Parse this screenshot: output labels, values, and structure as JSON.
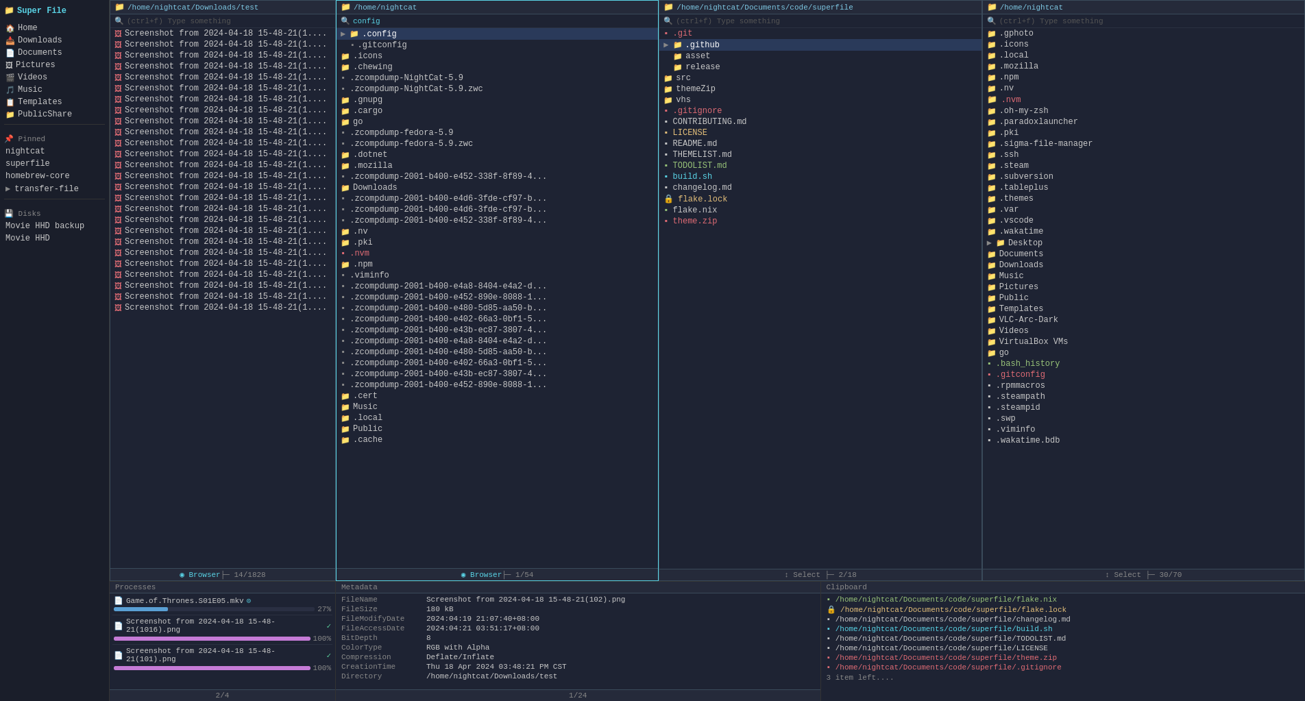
{
  "app": {
    "title": "Super File"
  },
  "sidebar": {
    "home_label": "Home",
    "pinned_label": "Pinned",
    "disks_label": "Disks",
    "items": [
      {
        "label": "Home",
        "icon": "🏠"
      },
      {
        "label": "Downloads",
        "icon": "📥"
      },
      {
        "label": "Documents",
        "icon": "📄"
      },
      {
        "label": "Pictures",
        "icon": "🖼"
      },
      {
        "label": "Videos",
        "icon": "🎬"
      },
      {
        "label": "Music",
        "icon": "🎵"
      },
      {
        "label": "Templates",
        "icon": "📋"
      },
      {
        "label": "PublicShare",
        "icon": "📁"
      }
    ],
    "pinned": [
      {
        "label": "nightcat"
      },
      {
        "label": "superfile"
      },
      {
        "label": "homebrew-core"
      },
      {
        "label": "transfer-file"
      }
    ],
    "disks": [
      {
        "label": "Movie HHD backup"
      },
      {
        "label": "Movie HHD"
      }
    ]
  },
  "panel1": {
    "path": "/home/nightcat/Downloads/test",
    "search_placeholder": "(ctrl+f) Type something",
    "files": [
      {
        "name": "Screenshot from 2024-04-18 15-48-21(1....",
        "type": "img"
      },
      {
        "name": "Screenshot from 2024-04-18 15-48-21(1....",
        "type": "img"
      },
      {
        "name": "Screenshot from 2024-04-18 15-48-21(1....",
        "type": "img"
      },
      {
        "name": "Screenshot from 2024-04-18 15-48-21(1....",
        "type": "img"
      },
      {
        "name": "Screenshot from 2024-04-18 15-48-21(1....",
        "type": "img"
      },
      {
        "name": "Screenshot from 2024-04-18 15-48-21(1....",
        "type": "img"
      },
      {
        "name": "Screenshot from 2024-04-18 15-48-21(1....",
        "type": "img"
      },
      {
        "name": "Screenshot from 2024-04-18 15-48-21(1....",
        "type": "img"
      },
      {
        "name": "Screenshot from 2024-04-18 15-48-21(1....",
        "type": "img"
      },
      {
        "name": "Screenshot from 2024-04-18 15-48-21(1....",
        "type": "img"
      },
      {
        "name": "Screenshot from 2024-04-18 15-48-21(1....",
        "type": "img"
      },
      {
        "name": "Screenshot from 2024-04-18 15-48-21(1....",
        "type": "img"
      },
      {
        "name": "Screenshot from 2024-04-18 15-48-21(1....",
        "type": "img"
      },
      {
        "name": "Screenshot from 2024-04-18 15-48-21(1....",
        "type": "img"
      },
      {
        "name": "Screenshot from 2024-04-18 15-48-21(1....",
        "type": "img"
      },
      {
        "name": "Screenshot from 2024-04-18 15-48-21(1....",
        "type": "img"
      },
      {
        "name": "Screenshot from 2024-04-18 15-48-21(1....",
        "type": "img"
      },
      {
        "name": "Screenshot from 2024-04-18 15-48-21(1....",
        "type": "img"
      },
      {
        "name": "Screenshot from 2024-04-18 15-48-21(1....",
        "type": "img"
      },
      {
        "name": "Screenshot from 2024-04-18 15-48-21(1....",
        "type": "img"
      },
      {
        "name": "Screenshot from 2024-04-18 15-48-21(1....",
        "type": "img"
      },
      {
        "name": "Screenshot from 2024-04-18 15-48-21(1....",
        "type": "img"
      },
      {
        "name": "Screenshot from 2024-04-18 15-48-21(1....",
        "type": "img"
      },
      {
        "name": "Screenshot from 2024-04-18 15-48-21(1....",
        "type": "img"
      },
      {
        "name": "Screenshot from 2024-04-18 15-48-21(1....",
        "type": "img"
      },
      {
        "name": "Screenshot from 2024-04-18 15-48-21(1....",
        "type": "img"
      }
    ],
    "footer": "◉ Browser ├─ 14/1828"
  },
  "panel2": {
    "path": "/home/nightcat",
    "search_value": "config",
    "files": [
      {
        "name": ".config",
        "type": "dir",
        "expanded": true
      },
      {
        "name": ".gitconfig",
        "type": "file"
      },
      {
        "name": ".icons",
        "type": "dir"
      },
      {
        "name": ".chewing",
        "type": "dir"
      },
      {
        "name": ".zcompdump-NightCat-5.9",
        "type": "file"
      },
      {
        "name": ".zcompdump-NightCat-5.9.zwc",
        "type": "file"
      },
      {
        "name": ".gnupg",
        "type": "dir"
      },
      {
        "name": ".cargo",
        "type": "dir"
      },
      {
        "name": "go",
        "type": "dir"
      },
      {
        "name": ".zcompdump-fedora-5.9",
        "type": "file"
      },
      {
        "name": ".zcompdump-fedora-5.9.zwc",
        "type": "file"
      },
      {
        "name": ".dotnet",
        "type": "dir"
      },
      {
        "name": ".mozilla",
        "type": "dir"
      },
      {
        "name": ".zcompdump-2001-b400-e452-338f-8f89-4...",
        "type": "file"
      },
      {
        "name": "Downloads",
        "type": "dir"
      },
      {
        "name": ".zcompdump-2001-b400-e4d6-3fde-cf97-b...",
        "type": "file"
      },
      {
        "name": ".zcompdump-2001-b400-e4d6-3fde-cf97-b...",
        "type": "file"
      },
      {
        "name": ".zcompdump-2001-b400-e452-338f-8f89-4...",
        "type": "file"
      },
      {
        "name": ".nv",
        "type": "dir"
      },
      {
        "name": ".pki",
        "type": "dir"
      },
      {
        "name": ".nvm",
        "type": "file",
        "red": true
      },
      {
        "name": ".npm",
        "type": "dir"
      },
      {
        "name": ".viminfo",
        "type": "file"
      },
      {
        "name": ".zcompdump-2001-b400-e4a8-8404-e4a2-d...",
        "type": "file"
      },
      {
        "name": ".zcompdump-2001-b400-e452-890e-8088-1...",
        "type": "file"
      },
      {
        "name": ".zcompdump-2001-b400-e480-5d85-aa50-b...",
        "type": "file"
      },
      {
        "name": ".zcompdump-2001-b400-e402-66a3-0bf1-5...",
        "type": "file"
      },
      {
        "name": ".zcompdump-2001-b400-e43b-ec87-3807-4...",
        "type": "file"
      },
      {
        "name": ".zcompdump-2001-b400-e4a8-8404-e4a2-d...",
        "type": "file"
      },
      {
        "name": ".zcompdump-2001-b400-e480-5d85-aa50-b...",
        "type": "file"
      },
      {
        "name": ".zcompdump-2001-b400-e402-66a3-0bf1-5...",
        "type": "file"
      },
      {
        "name": ".zcompdump-2001-b400-e43b-ec87-3807-4...",
        "type": "file"
      },
      {
        "name": ".zcompdump-2001-b400-e452-890e-8088-1...",
        "type": "file"
      },
      {
        "name": ".cert",
        "type": "dir"
      },
      {
        "name": "Music",
        "type": "dir"
      },
      {
        "name": ".local",
        "type": "dir"
      },
      {
        "name": "Public",
        "type": "dir"
      },
      {
        "name": ".cache",
        "type": "dir"
      }
    ],
    "footer": "◉ Browser ├─ 1/54"
  },
  "panel3": {
    "path": "/home/nightcat/Documents/code/superfile",
    "search_placeholder": "(ctrl+f) Type something",
    "files": [
      {
        "name": ".git",
        "type": "dir",
        "color": "red"
      },
      {
        "name": ".github",
        "type": "dir",
        "expanded": true
      },
      {
        "name": "asset",
        "type": "dir"
      },
      {
        "name": "release",
        "type": "dir"
      },
      {
        "name": "src",
        "type": "dir"
      },
      {
        "name": "themeZip",
        "type": "dir"
      },
      {
        "name": "vhs",
        "type": "dir"
      },
      {
        "name": ".gitignore",
        "type": "file",
        "color": "red"
      },
      {
        "name": "CONTRIBUTING.md",
        "type": "file"
      },
      {
        "name": "LICENSE",
        "type": "file",
        "color": "yellow"
      },
      {
        "name": "README.md",
        "type": "file"
      },
      {
        "name": "THEMELIST.md",
        "type": "file"
      },
      {
        "name": "TODOLIST.md",
        "type": "file",
        "color": "green"
      },
      {
        "name": "build.sh",
        "type": "file",
        "color": "green"
      },
      {
        "name": "changelog.md",
        "type": "file"
      },
      {
        "name": "flake.lock",
        "type": "file",
        "color": "yellow"
      },
      {
        "name": "flake.nix",
        "type": "file"
      },
      {
        "name": "theme.zip",
        "type": "file",
        "color": "red"
      }
    ],
    "footer": "↕ Select ├─ 2/18"
  },
  "panel4": {
    "path": "/home/nightcat",
    "search_placeholder": "(ctrl+f) Type something",
    "files": [
      {
        "name": ".gphoto",
        "type": "dir"
      },
      {
        "name": ".icons",
        "type": "dir"
      },
      {
        "name": ".local",
        "type": "dir"
      },
      {
        "name": ".mozilla",
        "type": "dir"
      },
      {
        "name": ".npm",
        "type": "dir"
      },
      {
        "name": ".nv",
        "type": "dir"
      },
      {
        "name": ".nvm",
        "type": "dir",
        "color": "red"
      },
      {
        "name": ".oh-my-zsh",
        "type": "dir"
      },
      {
        "name": ".paradoxlauncher",
        "type": "dir"
      },
      {
        "name": ".pki",
        "type": "dir"
      },
      {
        "name": ".sigma-file-manager",
        "type": "dir"
      },
      {
        "name": ".ssh",
        "type": "dir"
      },
      {
        "name": ".steam",
        "type": "dir"
      },
      {
        "name": ".subversion",
        "type": "dir"
      },
      {
        "name": ".tableplus",
        "type": "dir"
      },
      {
        "name": ".themes",
        "type": "dir"
      },
      {
        "name": ".var",
        "type": "dir"
      },
      {
        "name": ".vscode",
        "type": "dir"
      },
      {
        "name": ".wakatime",
        "type": "dir"
      },
      {
        "name": "Desktop",
        "type": "dir",
        "expanded": true
      },
      {
        "name": "Documents",
        "type": "dir"
      },
      {
        "name": "Downloads",
        "type": "dir"
      },
      {
        "name": "Music",
        "type": "dir"
      },
      {
        "name": "Pictures",
        "type": "dir"
      },
      {
        "name": "Public",
        "type": "dir"
      },
      {
        "name": "Templates",
        "type": "dir"
      },
      {
        "name": "VLC-Arc-Dark",
        "type": "dir"
      },
      {
        "name": "Videos",
        "type": "dir"
      },
      {
        "name": "VirtualBox VMs",
        "type": "dir"
      },
      {
        "name": "go",
        "type": "dir"
      },
      {
        "name": ".bash_history",
        "type": "file",
        "color": "green"
      },
      {
        "name": ".gitconfig",
        "type": "file",
        "color": "red"
      },
      {
        "name": ".rpmmacros",
        "type": "file"
      },
      {
        "name": ".steampath",
        "type": "file"
      },
      {
        "name": ".steampid",
        "type": "file"
      },
      {
        "name": ".swp",
        "type": "file"
      },
      {
        "name": ".viminfo",
        "type": "file"
      },
      {
        "name": ".wakatime.bdb",
        "type": "file"
      }
    ],
    "footer": "↕ Select ├─ 30/70"
  },
  "processes": {
    "title": "Processes",
    "items": [
      {
        "name": "Game.of.Thrones.S01E05.mkv",
        "pct": 27,
        "color": "blue",
        "icon": "spin"
      },
      {
        "name": "Screenshot from 2024-04-18 15-48-21(1016).png",
        "pct": 100,
        "color": "purple",
        "icon": "tick"
      },
      {
        "name": "Screenshot from 2024-04-18 15-48-21(101).png",
        "pct": 100,
        "color": "purple",
        "icon": "tick"
      }
    ],
    "page": "2/4"
  },
  "metadata": {
    "title": "Metadata",
    "rows": [
      {
        "key": "FileName",
        "val": "Screenshot from 2024-04-18 15-48-21(102).png"
      },
      {
        "key": "FileSize",
        "val": "180 kB"
      },
      {
        "key": "FileModifyDate",
        "val": "2024:04:19 21:07:40+08:00"
      },
      {
        "key": "FileAccessDate",
        "val": "2024:04:21 03:51:17+08:00"
      },
      {
        "key": "BitDepth",
        "val": "8"
      },
      {
        "key": "ColorType",
        "val": "RGB with Alpha"
      },
      {
        "key": "Compression",
        "val": "Deflate/Inflate"
      },
      {
        "key": "CreationTime",
        "val": "Thu 18 Apr 2024 03:48:21 PM CST"
      },
      {
        "key": "Directory",
        "val": "/home/nightcat/Downloads/test"
      }
    ],
    "footer": "1/24"
  },
  "clipboard": {
    "title": "Clipboard",
    "items": [
      {
        "path": "/home/nightcat/Documents/code/superfile/flake.nix",
        "color": "nix"
      },
      {
        "path": "/home/nightcat/Documents/code/superfile/flake.lock",
        "color": "lock"
      },
      {
        "path": "/home/nightcat/Documents/code/superfile/changelog.md",
        "color": "md"
      },
      {
        "path": "/home/nightcat/Documents/code/superfile/build.sh",
        "color": "sh"
      },
      {
        "path": "/home/nightcat/Documents/code/superfile/TODOLIST.md",
        "color": "md"
      },
      {
        "path": "/home/nightcat/Documents/code/superfile/LICENSE",
        "color": "md"
      },
      {
        "path": "/home/nightcat/Documents/code/superfile/theme.zip",
        "color": "zip"
      },
      {
        "path": "/home/nightcat/Documents/code/superfile/.gitignore",
        "color": "gitignore"
      }
    ],
    "remain": "3 item left...."
  }
}
